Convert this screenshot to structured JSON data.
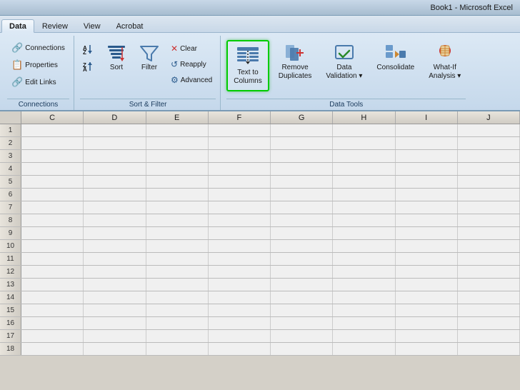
{
  "titleBar": {
    "text": "Book1 - Microsoft Excel"
  },
  "tabs": [
    {
      "label": "Data",
      "active": true
    },
    {
      "label": "Review",
      "active": false
    },
    {
      "label": "View",
      "active": false
    },
    {
      "label": "Acrobat",
      "active": false
    }
  ],
  "ribbon": {
    "groups": [
      {
        "id": "connections",
        "label": "Connections",
        "buttons": [
          {
            "id": "connections-btn",
            "label": "Connections",
            "type": "small"
          },
          {
            "id": "properties-btn",
            "label": "Properties",
            "type": "small"
          },
          {
            "id": "edit-links-btn",
            "label": "Edit Links",
            "type": "small"
          }
        ]
      },
      {
        "id": "sort-filter",
        "label": "Sort & Filter",
        "buttons": [
          {
            "id": "sort-az-btn",
            "label": "Sort A-Z",
            "type": "small-icon"
          },
          {
            "id": "sort-za-btn",
            "label": "Sort Z-A",
            "type": "small-icon"
          },
          {
            "id": "sort-btn",
            "label": "Sort",
            "type": "large"
          },
          {
            "id": "filter-btn",
            "label": "Filter",
            "type": "large"
          },
          {
            "id": "clear-btn",
            "label": "Clear",
            "type": "small"
          },
          {
            "id": "reapply-btn",
            "label": "Reapply",
            "type": "small"
          },
          {
            "id": "advanced-btn",
            "label": "Advanced",
            "type": "small"
          }
        ]
      },
      {
        "id": "data-tools",
        "label": "Data Tools",
        "buttons": [
          {
            "id": "text-to-columns-btn",
            "label": "Text to\nColumns",
            "type": "large",
            "highlighted": true
          },
          {
            "id": "remove-duplicates-btn",
            "label": "Remove\nDuplicates",
            "type": "large"
          },
          {
            "id": "data-validation-btn",
            "label": "Data\nValidation",
            "type": "large"
          },
          {
            "id": "consolidate-btn",
            "label": "Consolidate",
            "type": "large"
          },
          {
            "id": "what-if-btn",
            "label": "What-If\nAnalysis",
            "type": "large"
          }
        ]
      }
    ]
  },
  "spreadsheet": {
    "columns": [
      "C",
      "D",
      "E",
      "F",
      "G",
      "H",
      "I",
      "J"
    ],
    "rowCount": 18
  }
}
